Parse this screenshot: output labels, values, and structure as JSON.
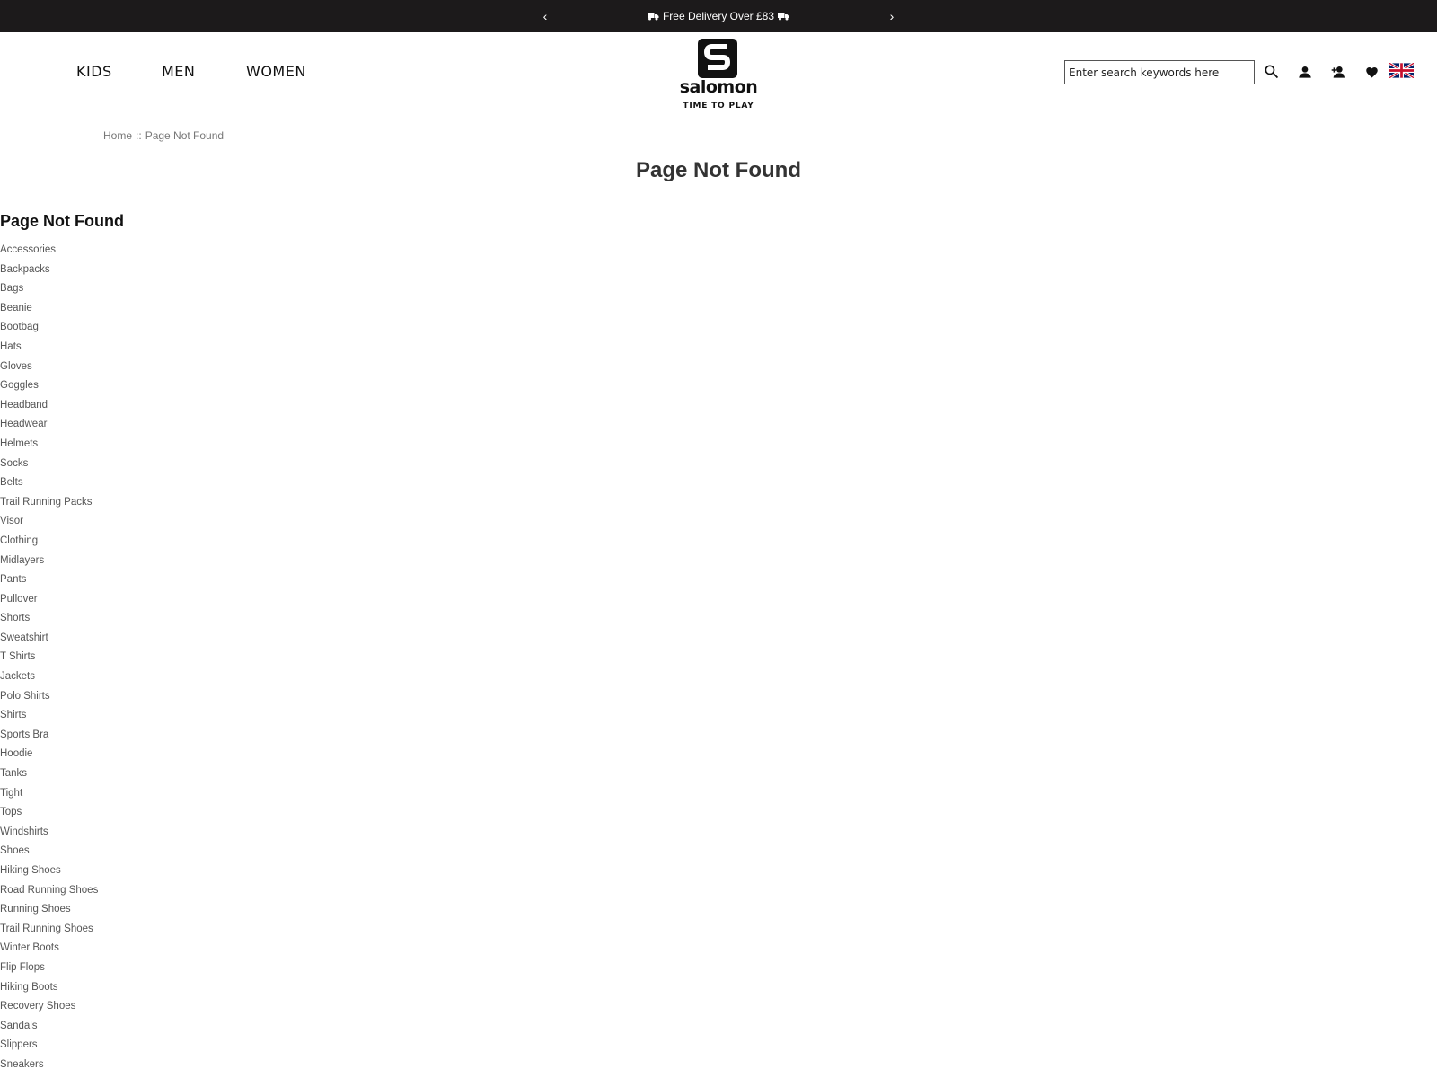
{
  "promo": {
    "message": "Free Delivery Over £83",
    "prev_icon": "chevron-left-icon",
    "next_icon": "chevron-right-icon"
  },
  "nav": {
    "kids": "KIDS",
    "men": "MEN",
    "women": "WOMEN"
  },
  "logo": {
    "word": "salomon",
    "tagline": "TIME TO PLAY"
  },
  "search": {
    "placeholder": "Enter search keywords here",
    "value": ""
  },
  "icons": {
    "search": "search-icon",
    "account": "user-icon",
    "register": "user-add-icon",
    "wishlist": "heart-icon",
    "language": "uk-flag-icon"
  },
  "breadcrumb": {
    "home": "Home",
    "separator": "::",
    "current": "Page Not Found"
  },
  "page_title": "Page Not Found",
  "sidebar": {
    "heading": "Page Not Found",
    "items": [
      "Accessories",
      "Backpacks",
      "Bags",
      "Beanie",
      "Bootbag",
      "Hats",
      "Gloves",
      "Goggles",
      "Headband",
      "Headwear",
      "Helmets",
      "Socks",
      "Belts",
      "Trail Running Packs",
      "Visor",
      "Clothing",
      "Midlayers",
      "Pants",
      "Pullover",
      "Shorts",
      "Sweatshirt",
      "T Shirts",
      "Jackets",
      "Polo Shirts",
      "Shirts",
      "Sports Bra",
      "Hoodie",
      "Tanks",
      "Tight",
      "Tops",
      "Windshirts",
      "Shoes",
      "Hiking Shoes",
      "Road Running Shoes",
      "Running Shoes",
      "Trail Running Shoes",
      "Winter Boots",
      "Flip Flops",
      "Hiking Boots",
      "Recovery Shoes",
      "Sandals",
      "Slippers",
      "Sneakers"
    ]
  }
}
